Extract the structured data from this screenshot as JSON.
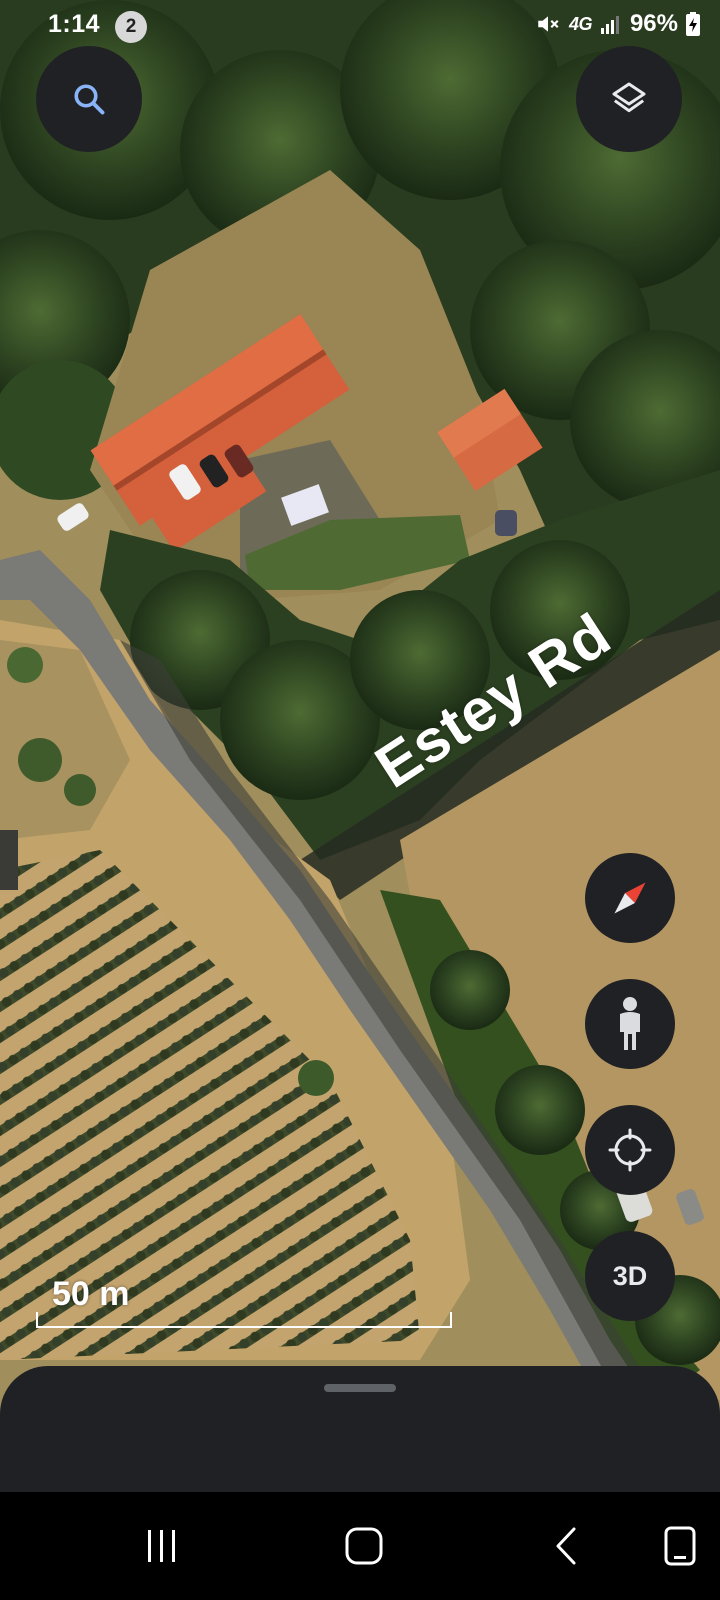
{
  "status_bar": {
    "time": "1:14",
    "notification_count": "2",
    "network": "4G",
    "battery": "96%"
  },
  "map": {
    "type": "satellite",
    "road_label": "Estey Rd",
    "scale_label": "50 m"
  },
  "controls": {
    "search_icon": "search-icon",
    "layers_icon": "layers-icon",
    "compass_icon": "compass-icon",
    "street_view_icon": "pegman-icon",
    "my_location_icon": "crosshair-icon",
    "three_d_label": "3D"
  },
  "bottom_sheet": {
    "handle": "drag-handle"
  },
  "navigation_bar": {
    "recent_icon": "recent-apps-icon",
    "home_icon": "home-icon",
    "back_icon": "back-icon",
    "assist_icon": "keyboard-icon"
  },
  "colors": {
    "control_bg": "#202124",
    "compass_red": "#ea4335",
    "roof": "#d4603c"
  }
}
